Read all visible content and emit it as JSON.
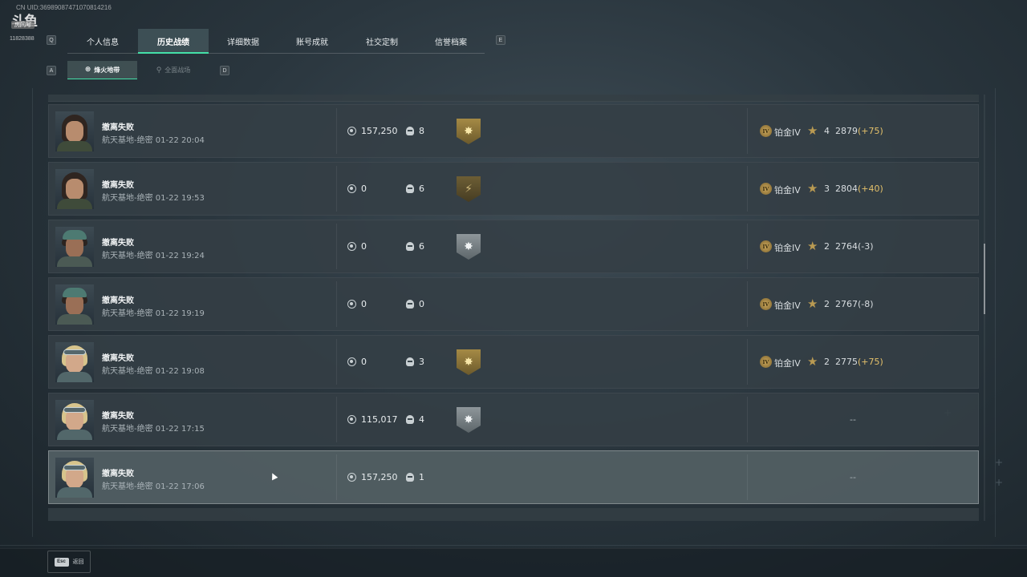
{
  "watermark": {
    "uid": "CN UID:3698908747107081421​6",
    "room_label": "房间号",
    "room_number": "11828388"
  },
  "keys": {
    "prev_tab": "Q",
    "next_tab": "E",
    "prev_sub": "A",
    "next_sub": "D",
    "back": "Esc"
  },
  "tabs": [
    {
      "label": "个人信息",
      "active": false
    },
    {
      "label": "历史战绩",
      "active": true
    },
    {
      "label": "详细数据",
      "active": false
    },
    {
      "label": "账号成就",
      "active": false
    },
    {
      "label": "社交定制",
      "active": false
    },
    {
      "label": "信誉档案",
      "active": false
    }
  ],
  "sub_tabs": [
    {
      "label": "烽火地带",
      "icon": "radar-icon",
      "active": true
    },
    {
      "label": "全面战场",
      "icon": "tower-icon",
      "active": false
    }
  ],
  "matches": [
    {
      "avatar": "v1",
      "result": "撤离失败",
      "map_mode": "航天基地-绝密",
      "time": "01-22 20:04",
      "value": "157,250",
      "kills": "8",
      "badge": "gold",
      "badge_icon": "burst-emblem-icon",
      "rank": "铂金IV",
      "rank_numeral": "IV",
      "stars": "4",
      "score": "2879",
      "delta": "(+75)",
      "delta_positive": true
    },
    {
      "avatar": "v1",
      "result": "撤离失败",
      "map_mode": "航天基地-绝密",
      "time": "01-22 19:53",
      "value": "0",
      "kills": "6",
      "badge": "gold-dim",
      "badge_icon": "runner-emblem-icon",
      "rank": "铂金IV",
      "rank_numeral": "IV",
      "stars": "3",
      "score": "2804",
      "delta": "(+40)",
      "delta_positive": true
    },
    {
      "avatar": "v2",
      "result": "撤离失败",
      "map_mode": "航天基地-绝密",
      "time": "01-22 19:24",
      "value": "0",
      "kills": "6",
      "badge": "silver",
      "badge_icon": "burst-emblem-icon",
      "rank": "铂金IV",
      "rank_numeral": "IV",
      "stars": "2",
      "score": "2764",
      "delta": "(-3)",
      "delta_positive": false
    },
    {
      "avatar": "v2",
      "result": "撤离失败",
      "map_mode": "航天基地-绝密",
      "time": "01-22 19:19",
      "value": "0",
      "kills": "0",
      "badge": "",
      "badge_icon": "",
      "rank": "铂金IV",
      "rank_numeral": "IV",
      "stars": "2",
      "score": "2767",
      "delta": "(-8)",
      "delta_positive": false
    },
    {
      "avatar": "v3",
      "result": "撤离失败",
      "map_mode": "航天基地-绝密",
      "time": "01-22 19:08",
      "value": "0",
      "kills": "3",
      "badge": "gold",
      "badge_icon": "burst-emblem-icon",
      "rank": "铂金IV",
      "rank_numeral": "IV",
      "stars": "2",
      "score": "2775",
      "delta": "(+75)",
      "delta_positive": true
    },
    {
      "avatar": "v3",
      "result": "撤离失败",
      "map_mode": "航天基地-绝密",
      "time": "01-22 17:15",
      "value": "115,017",
      "kills": "4",
      "badge": "silver",
      "badge_icon": "burst-emblem-icon",
      "rank": "",
      "rank_numeral": "",
      "stars": "",
      "score": "",
      "delta": "",
      "delta_positive": false,
      "no_rank": "--"
    },
    {
      "avatar": "v3",
      "result": "撤离失败",
      "map_mode": "航天基地-绝密",
      "time": "01-22 17:06",
      "value": "157,250",
      "kills": "1",
      "badge": "",
      "badge_icon": "",
      "rank": "",
      "rank_numeral": "",
      "stars": "",
      "score": "",
      "delta": "",
      "delta_positive": false,
      "no_rank": "--",
      "highlighted": true
    }
  ],
  "bottom": {
    "back_label": "返回"
  }
}
